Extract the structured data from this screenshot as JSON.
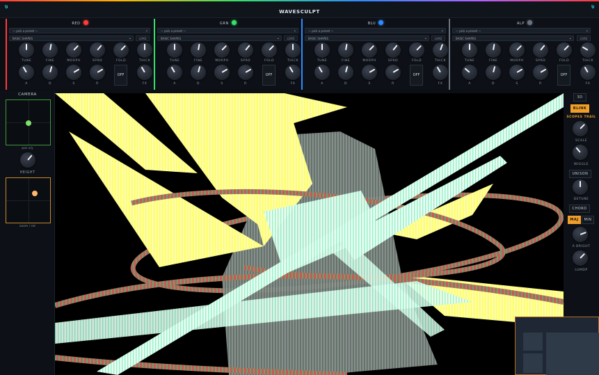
{
  "app": {
    "title": "WAVESCULPT",
    "corner_left": "ʋ",
    "corner_right": "ʋ"
  },
  "knob_labels_row1": [
    "TUNE",
    "FINE",
    "MORPH",
    "SPRD",
    "FOLD",
    "THICK"
  ],
  "knob_labels_row2": [
    "A",
    "D",
    "S",
    "R",
    "",
    "FX"
  ],
  "channels": [
    {
      "name": "RED",
      "color": "#ff3b3b",
      "preset_placeholder": "— pick a preset —",
      "bank": "BASIC SHAPES",
      "load_label": "LOAD",
      "off_label": "OFF",
      "row1_angles": [
        0,
        10,
        45,
        40,
        45,
        0
      ],
      "row2_angles": [
        -30,
        15,
        60,
        60,
        null,
        -30
      ]
    },
    {
      "name": "GRN",
      "color": "#35e06b",
      "preset_placeholder": "— pick a preset —",
      "bank": "BASIC SHAPES",
      "load_label": "LOAD",
      "off_label": "OFF",
      "row1_angles": [
        0,
        10,
        45,
        40,
        45,
        0
      ],
      "row2_angles": [
        -30,
        15,
        60,
        60,
        null,
        -30
      ]
    },
    {
      "name": "BLU",
      "color": "#2f8bff",
      "preset_placeholder": "— pick a preset —",
      "bank": "BASIC SHAPES",
      "load_label": "LOAD",
      "off_label": "OFF",
      "row1_angles": [
        0,
        10,
        45,
        40,
        45,
        20
      ],
      "row2_angles": [
        -30,
        15,
        60,
        60,
        null,
        -30
      ]
    },
    {
      "name": "ALP",
      "color": "#6b7380",
      "preset_placeholder": "— pick a preset —",
      "bank": "BASIC SHAPES",
      "load_label": "LOAD",
      "off_label": "OFF",
      "row1_angles": [
        0,
        10,
        45,
        40,
        45,
        -60
      ],
      "row2_angles": [
        -50,
        15,
        60,
        60,
        null,
        -30
      ]
    }
  ],
  "camera": {
    "title": "CAMERA",
    "pos_caption": "pos x/y",
    "height_label": "HEIGHT",
    "orbit_caption": "zoom / rot",
    "pos_dot_color": "#7ee06b",
    "orbit_dot_color": "#ffb86a"
  },
  "right_panel": {
    "btn_3d": "3D",
    "blink": "BLINK",
    "scopes_trail": "SCOPES TRAIL",
    "scale": "SCALE",
    "wiggle": "WIGGLE",
    "unison": "UNISON",
    "detune": "DETUNE",
    "chord": "CHORD",
    "maj": "MAJ",
    "min": "MIN",
    "a_bright": "A BRIGHT",
    "lumdp": "LUMDP"
  }
}
